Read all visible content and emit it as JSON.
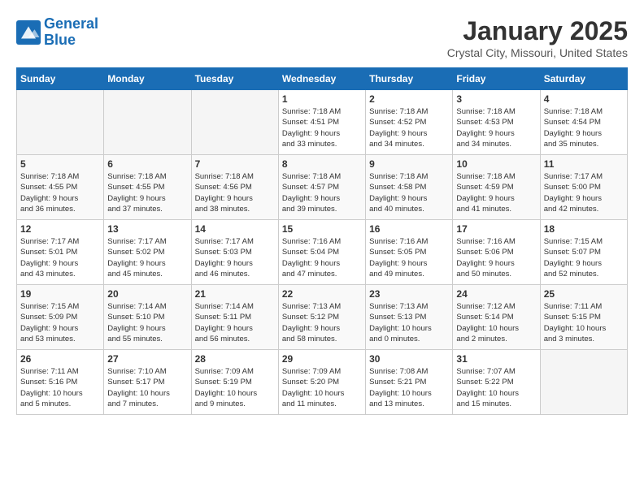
{
  "header": {
    "logo_line1": "General",
    "logo_line2": "Blue",
    "month": "January 2025",
    "location": "Crystal City, Missouri, United States"
  },
  "days_of_week": [
    "Sunday",
    "Monday",
    "Tuesday",
    "Wednesday",
    "Thursday",
    "Friday",
    "Saturday"
  ],
  "weeks": [
    [
      {
        "num": "",
        "info": ""
      },
      {
        "num": "",
        "info": ""
      },
      {
        "num": "",
        "info": ""
      },
      {
        "num": "1",
        "info": "Sunrise: 7:18 AM\nSunset: 4:51 PM\nDaylight: 9 hours\nand 33 minutes."
      },
      {
        "num": "2",
        "info": "Sunrise: 7:18 AM\nSunset: 4:52 PM\nDaylight: 9 hours\nand 34 minutes."
      },
      {
        "num": "3",
        "info": "Sunrise: 7:18 AM\nSunset: 4:53 PM\nDaylight: 9 hours\nand 34 minutes."
      },
      {
        "num": "4",
        "info": "Sunrise: 7:18 AM\nSunset: 4:54 PM\nDaylight: 9 hours\nand 35 minutes."
      }
    ],
    [
      {
        "num": "5",
        "info": "Sunrise: 7:18 AM\nSunset: 4:55 PM\nDaylight: 9 hours\nand 36 minutes."
      },
      {
        "num": "6",
        "info": "Sunrise: 7:18 AM\nSunset: 4:55 PM\nDaylight: 9 hours\nand 37 minutes."
      },
      {
        "num": "7",
        "info": "Sunrise: 7:18 AM\nSunset: 4:56 PM\nDaylight: 9 hours\nand 38 minutes."
      },
      {
        "num": "8",
        "info": "Sunrise: 7:18 AM\nSunset: 4:57 PM\nDaylight: 9 hours\nand 39 minutes."
      },
      {
        "num": "9",
        "info": "Sunrise: 7:18 AM\nSunset: 4:58 PM\nDaylight: 9 hours\nand 40 minutes."
      },
      {
        "num": "10",
        "info": "Sunrise: 7:18 AM\nSunset: 4:59 PM\nDaylight: 9 hours\nand 41 minutes."
      },
      {
        "num": "11",
        "info": "Sunrise: 7:17 AM\nSunset: 5:00 PM\nDaylight: 9 hours\nand 42 minutes."
      }
    ],
    [
      {
        "num": "12",
        "info": "Sunrise: 7:17 AM\nSunset: 5:01 PM\nDaylight: 9 hours\nand 43 minutes."
      },
      {
        "num": "13",
        "info": "Sunrise: 7:17 AM\nSunset: 5:02 PM\nDaylight: 9 hours\nand 45 minutes."
      },
      {
        "num": "14",
        "info": "Sunrise: 7:17 AM\nSunset: 5:03 PM\nDaylight: 9 hours\nand 46 minutes."
      },
      {
        "num": "15",
        "info": "Sunrise: 7:16 AM\nSunset: 5:04 PM\nDaylight: 9 hours\nand 47 minutes."
      },
      {
        "num": "16",
        "info": "Sunrise: 7:16 AM\nSunset: 5:05 PM\nDaylight: 9 hours\nand 49 minutes."
      },
      {
        "num": "17",
        "info": "Sunrise: 7:16 AM\nSunset: 5:06 PM\nDaylight: 9 hours\nand 50 minutes."
      },
      {
        "num": "18",
        "info": "Sunrise: 7:15 AM\nSunset: 5:07 PM\nDaylight: 9 hours\nand 52 minutes."
      }
    ],
    [
      {
        "num": "19",
        "info": "Sunrise: 7:15 AM\nSunset: 5:09 PM\nDaylight: 9 hours\nand 53 minutes."
      },
      {
        "num": "20",
        "info": "Sunrise: 7:14 AM\nSunset: 5:10 PM\nDaylight: 9 hours\nand 55 minutes."
      },
      {
        "num": "21",
        "info": "Sunrise: 7:14 AM\nSunset: 5:11 PM\nDaylight: 9 hours\nand 56 minutes."
      },
      {
        "num": "22",
        "info": "Sunrise: 7:13 AM\nSunset: 5:12 PM\nDaylight: 9 hours\nand 58 minutes."
      },
      {
        "num": "23",
        "info": "Sunrise: 7:13 AM\nSunset: 5:13 PM\nDaylight: 10 hours\nand 0 minutes."
      },
      {
        "num": "24",
        "info": "Sunrise: 7:12 AM\nSunset: 5:14 PM\nDaylight: 10 hours\nand 2 minutes."
      },
      {
        "num": "25",
        "info": "Sunrise: 7:11 AM\nSunset: 5:15 PM\nDaylight: 10 hours\nand 3 minutes."
      }
    ],
    [
      {
        "num": "26",
        "info": "Sunrise: 7:11 AM\nSunset: 5:16 PM\nDaylight: 10 hours\nand 5 minutes."
      },
      {
        "num": "27",
        "info": "Sunrise: 7:10 AM\nSunset: 5:17 PM\nDaylight: 10 hours\nand 7 minutes."
      },
      {
        "num": "28",
        "info": "Sunrise: 7:09 AM\nSunset: 5:19 PM\nDaylight: 10 hours\nand 9 minutes."
      },
      {
        "num": "29",
        "info": "Sunrise: 7:09 AM\nSunset: 5:20 PM\nDaylight: 10 hours\nand 11 minutes."
      },
      {
        "num": "30",
        "info": "Sunrise: 7:08 AM\nSunset: 5:21 PM\nDaylight: 10 hours\nand 13 minutes."
      },
      {
        "num": "31",
        "info": "Sunrise: 7:07 AM\nSunset: 5:22 PM\nDaylight: 10 hours\nand 15 minutes."
      },
      {
        "num": "",
        "info": ""
      }
    ]
  ]
}
